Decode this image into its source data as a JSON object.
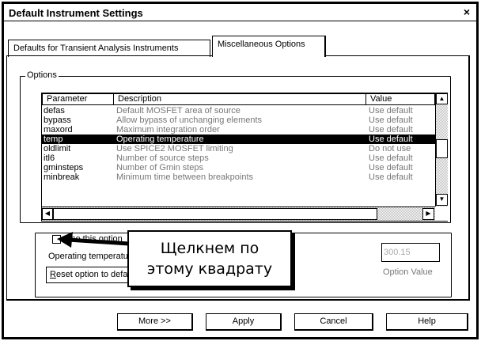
{
  "window": {
    "title": "Default Instrument Settings",
    "close_glyph": "×"
  },
  "tabs": [
    {
      "label": "Defaults for Transient Analysis Instruments"
    },
    {
      "label": "Miscellaneous Options"
    }
  ],
  "options_group": {
    "legend": "Options"
  },
  "table": {
    "columns": [
      "Parameter",
      "Description",
      "Value"
    ],
    "rows": [
      {
        "param": "defas",
        "desc": "Default MOSFET area of source",
        "value": "Use default"
      },
      {
        "param": "bypass",
        "desc": "Allow bypass of unchanging elements",
        "value": "Use default"
      },
      {
        "param": "maxord",
        "desc": "Maximum integration order",
        "value": "Use default"
      },
      {
        "param": "temp",
        "desc": "Operating temperature",
        "value": "Use default",
        "selected": true
      },
      {
        "param": "oldlimit",
        "desc": "Use SPICE2 MOSFET limiting",
        "value": "Do not use"
      },
      {
        "param": "itl6",
        "desc": "Number of source steps",
        "value": "Use default"
      },
      {
        "param": "gminsteps",
        "desc": "Number of Gmin steps",
        "value": "Use default"
      },
      {
        "param": "minbreak",
        "desc": "Minimum time between breakpoints",
        "value": "Use default"
      }
    ],
    "scroll_up_glyph": "▲",
    "scroll_down_glyph": "▼",
    "scroll_left_glyph": "◀",
    "scroll_right_glyph": "▶"
  },
  "option_panel": {
    "use_label": "Use this option",
    "temp_label": "Operating temperature",
    "reset_label_u": "R",
    "reset_label_rest": "eset option to default",
    "value_input": "300.15",
    "value_label": "Option Value"
  },
  "callout": {
    "line1": "Щелкнем по",
    "line2": "этому квадрату"
  },
  "buttons": {
    "more": "More >>",
    "apply": "Apply",
    "cancel": "Cancel",
    "help": "Help"
  }
}
